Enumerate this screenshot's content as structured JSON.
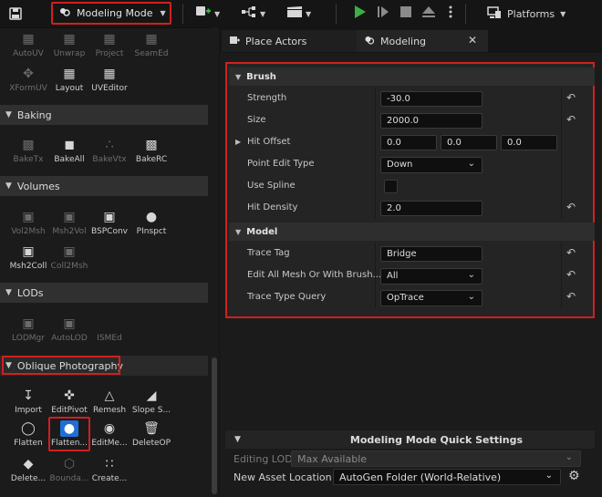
{
  "toolbar": {
    "mode_label": "Modeling Mode",
    "platforms_label": "Platforms",
    "icons": [
      "save-icon",
      "modeling-mode-icon",
      "add-actor-icon",
      "blueprint-icon",
      "cinematics-icon",
      "play-icon",
      "step-icon",
      "stop-icon",
      "eject-icon",
      "more-icon",
      "platforms-icon"
    ]
  },
  "left_panel": {
    "top_tools": [
      {
        "label": "AutoUV",
        "dim": true
      },
      {
        "label": "Unwrap",
        "dim": true
      },
      {
        "label": "Project",
        "dim": true
      },
      {
        "label": "SeamEd",
        "dim": true
      },
      {
        "label": "XFormUV",
        "dim": true
      },
      {
        "label": "Layout",
        "dim": false
      },
      {
        "label": "UVEditor",
        "dim": false
      }
    ],
    "sections": {
      "baking": {
        "title": "Baking",
        "tools": [
          {
            "label": "BakeTx",
            "dim": true
          },
          {
            "label": "BakeAll",
            "dim": false
          },
          {
            "label": "BakeVtx",
            "dim": true
          },
          {
            "label": "BakeRC",
            "dim": false
          }
        ]
      },
      "volumes": {
        "title": "Volumes",
        "tools": [
          {
            "label": "Vol2Msh",
            "dim": true
          },
          {
            "label": "Msh2Vol",
            "dim": true
          },
          {
            "label": "BSPConv",
            "dim": false
          },
          {
            "label": "PInspct",
            "dim": false
          },
          {
            "label": "Msh2Coll",
            "dim": false
          },
          {
            "label": "Coll2Msh",
            "dim": true
          }
        ]
      },
      "lods": {
        "title": "LODs",
        "tools": [
          {
            "label": "LODMgr",
            "dim": true
          },
          {
            "label": "AutoLOD",
            "dim": true
          },
          {
            "label": "ISMEd",
            "dim": true
          }
        ]
      },
      "oblique": {
        "title": "Oblique Photography",
        "tools": [
          {
            "label": "Import",
            "dim": false
          },
          {
            "label": "EditPivot",
            "dim": false
          },
          {
            "label": "Remesh",
            "dim": false
          },
          {
            "label": "Slope S...",
            "dim": false
          },
          {
            "label": "Flatten",
            "dim": false
          },
          {
            "label": "Flatten...",
            "dim": false
          },
          {
            "label": "EditMe...",
            "dim": false
          },
          {
            "label": "DeleteOP",
            "dim": false
          },
          {
            "label": "Delete...",
            "dim": false
          },
          {
            "label": "Bounda...",
            "dim": true
          },
          {
            "label": "Create...",
            "dim": false
          }
        ]
      }
    }
  },
  "tabs": {
    "place_actors": "Place Actors",
    "modeling": "Modeling"
  },
  "details": {
    "brush": {
      "title": "Brush",
      "strength_label": "Strength",
      "strength_value": "-30.0",
      "size_label": "Size",
      "size_value": "2000.0",
      "hit_offset_label": "Hit Offset",
      "hit_offset_x": "0.0",
      "hit_offset_y": "0.0",
      "hit_offset_z": "0.0",
      "point_edit_type_label": "Point Edit Type",
      "point_edit_type_value": "Down",
      "use_spline_label": "Use Spline",
      "use_spline_checked": false,
      "hit_density_label": "Hit Density",
      "hit_density_value": "2.0"
    },
    "model": {
      "title": "Model",
      "trace_tag_label": "Trace Tag",
      "trace_tag_value": "Bridge",
      "edit_all_label": "Edit All Mesh Or With Brush...",
      "edit_all_value": "All",
      "trace_type_label": "Trace Type Query",
      "trace_type_value": "OpTrace"
    }
  },
  "quick_settings": {
    "title": "Modeling Mode Quick Settings",
    "editing_lod_label": "Editing LOD",
    "editing_lod_value": "Max Available",
    "new_asset_label": "New Asset Location",
    "new_asset_value": "AutoGen Folder (World-Relative)"
  },
  "colors": {
    "highlight_red": "#d02020",
    "play_green": "#3cb043",
    "selected_blue": "#1f6fd6"
  }
}
